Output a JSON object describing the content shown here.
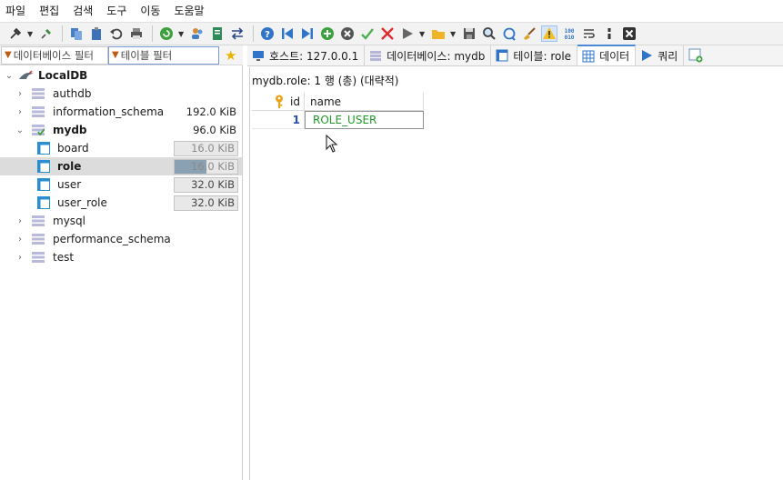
{
  "menu": [
    "파일",
    "편집",
    "검색",
    "도구",
    "이동",
    "도움말"
  ],
  "toolbar": {
    "icons": [
      "plug-icon",
      "disconnect-icon",
      "copy-icon",
      "paste-icon",
      "undo-icon",
      "print-icon",
      "refresh-icon",
      "user-manager-icon",
      "export-icon",
      "transfer-icon",
      "help-icon",
      "first-record-icon",
      "last-record-icon",
      "insert-row-icon",
      "cancel-icon",
      "apply-icon",
      "delete-icon",
      "run-icon",
      "folder-icon",
      "save-icon",
      "find-icon",
      "replace-icon",
      "brush-icon",
      "warning-icon",
      "binary-icon",
      "wrap-icon",
      "comment-icon",
      "close-icon"
    ]
  },
  "filters": {
    "database_placeholder": "데이터베이스 필터",
    "table_placeholder": "테이블 필터"
  },
  "tabs": [
    {
      "label": "호스트: 127.0.0.1",
      "icon": "host-icon"
    },
    {
      "label": "데이터베이스: mydb",
      "icon": "database-icon"
    },
    {
      "label": "테이블: role",
      "icon": "table-icon"
    },
    {
      "label": "데이터",
      "icon": "grid-icon",
      "active": true
    },
    {
      "label": "쿼리",
      "icon": "play-icon"
    }
  ],
  "tree": {
    "root": "LocalDB",
    "databases": [
      {
        "name": "authdb",
        "size": ""
      },
      {
        "name": "information_schema",
        "size": "192.0 KiB"
      },
      {
        "name": "mydb",
        "size": "96.0 KiB",
        "expanded": true,
        "tables": [
          {
            "name": "board",
            "size": "16.0 KiB",
            "fill": 0.5
          },
          {
            "name": "role",
            "size": "16.0 KiB",
            "fill": 0.5,
            "selected": true
          },
          {
            "name": "user",
            "size": "32.0 KiB",
            "fill": 1.0
          },
          {
            "name": "user_role",
            "size": "32.0 KiB",
            "fill": 1.0
          }
        ]
      },
      {
        "name": "mysql",
        "size": ""
      },
      {
        "name": "performance_schema",
        "size": ""
      },
      {
        "name": "test",
        "size": ""
      }
    ]
  },
  "data": {
    "summary": "mydb.role: 1 행 (총) (대략적)",
    "columns": [
      "id",
      "name"
    ],
    "rows": [
      {
        "id": "1",
        "name": "ROLE_USER"
      }
    ]
  },
  "colors": {
    "accent": "#4a8ad6",
    "selected_row": "#dcdcdc",
    "row_number": "#2a4fb0",
    "cell_text_green": "#1e9a28",
    "size_fill": "#8aa1b4"
  }
}
